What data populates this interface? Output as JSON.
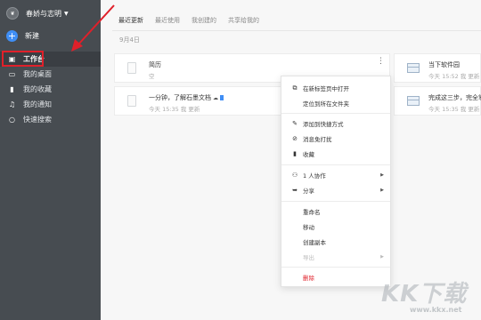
{
  "sidebar": {
    "user_name": "春娇与志明",
    "new_label": "新建",
    "items": [
      {
        "label": "工作台",
        "icon": "briefcase-icon",
        "glyph": "▣"
      },
      {
        "label": "我的桌面",
        "icon": "desktop-icon",
        "glyph": "▭"
      },
      {
        "label": "我的收藏",
        "icon": "bookmark-icon",
        "glyph": "▮"
      },
      {
        "label": "我的通知",
        "icon": "bell-icon",
        "glyph": "♫"
      },
      {
        "label": "快速搜索",
        "icon": "search-icon",
        "glyph": "○"
      }
    ]
  },
  "main": {
    "tabs": [
      "最近更新",
      "最近使用",
      "我创建的",
      "共享给我的"
    ],
    "date_label": "9月4日",
    "cards": [
      {
        "title": "简历",
        "sub": "空"
      },
      {
        "title": "一分钟，了解石墨文档",
        "sub": "今天 15:35 我 更新"
      },
      {
        "title": "当下软件园",
        "sub": "今天 15:52 我 更新"
      },
      {
        "title": "完成这三步，完全掌",
        "sub": "今天 15:35 我 更新"
      }
    ]
  },
  "menu": {
    "items": [
      {
        "label": "在新标签页中打开",
        "icon": "external-link-icon"
      },
      {
        "label": "定位到所在文件夹",
        "icon": ""
      },
      {
        "label": "添加到快捷方式",
        "icon": "pin-icon"
      },
      {
        "label": "消息免打扰",
        "icon": "mute-icon"
      },
      {
        "label": "收藏",
        "icon": "bookmark-icon"
      },
      {
        "label": "1 人协作",
        "icon": "people-icon"
      },
      {
        "label": "分享",
        "icon": "share-icon"
      },
      {
        "label": "重命名",
        "icon": ""
      },
      {
        "label": "移动",
        "icon": ""
      },
      {
        "label": "创建副本",
        "icon": ""
      },
      {
        "label": "导出",
        "icon": ""
      },
      {
        "label": "删除",
        "icon": ""
      }
    ]
  },
  "watermark": {
    "big": "KK下载",
    "small": "www.kkx.net"
  },
  "colors": {
    "sidebar": "#474c51",
    "accent": "#3f8ef5",
    "danger": "#e0202a",
    "highlight": "#e0202a"
  }
}
